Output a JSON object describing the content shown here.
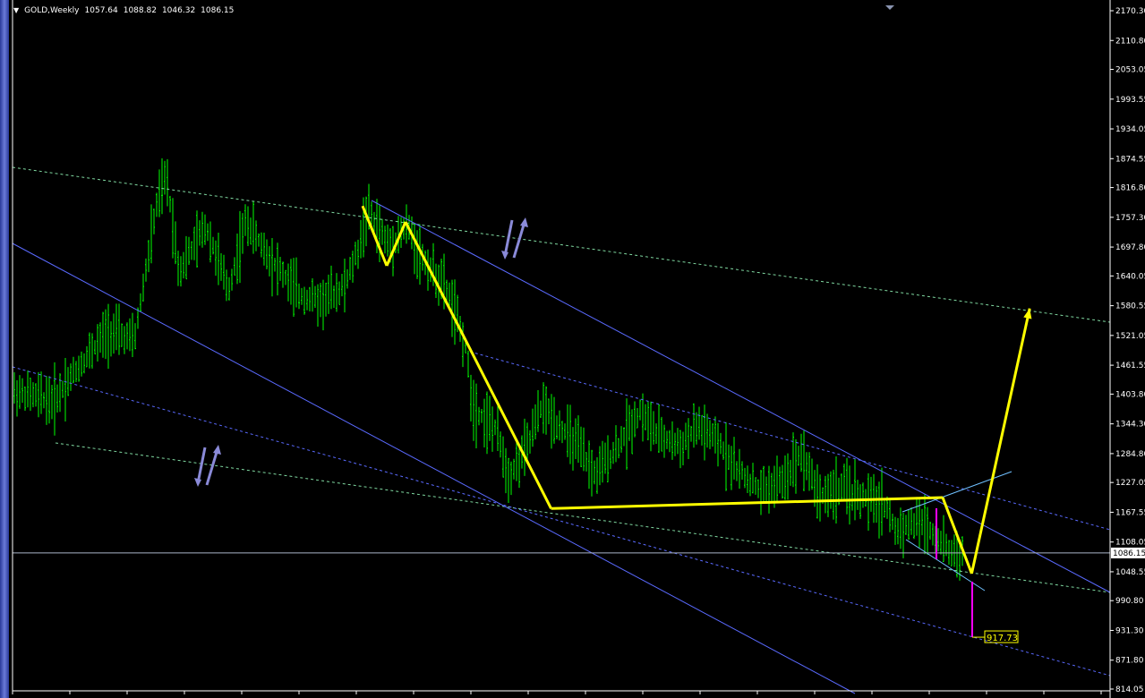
{
  "header": {
    "symbol": "GOLD,Weekly",
    "open": "1057.64",
    "high": "1088.82",
    "low": "1046.32",
    "close": "1086.15"
  },
  "chart_data": {
    "type": "line",
    "symbol": "GOLD",
    "timeframe": "Weekly",
    "y_ticks": [
      "2170.30",
      "2110.80",
      "2053.05",
      "1993.55",
      "1934.05",
      "1874.55",
      "1816.80",
      "1757.30",
      "1697.80",
      "1640.05",
      "1580.55",
      "1521.05",
      "1461.55",
      "1403.80",
      "1344.30",
      "1284.80",
      "1227.05",
      "1167.55",
      "1108.05",
      "1048.55",
      "990.80",
      "931.30",
      "871.80",
      "814.05"
    ],
    "ylim": [
      814.05,
      2170.3
    ],
    "current_price_label": "1086.15",
    "current_price": 1086.15,
    "target_label": "917.73",
    "target_value": 917.73,
    "zigzag_path": [
      {
        "x": 0.0,
        "y": 1780
      },
      {
        "x": 0.04,
        "y": 1710
      },
      {
        "x": 0.08,
        "y": 1760
      },
      {
        "x": 0.26,
        "y": 1175
      },
      {
        "x": 0.8,
        "y": 1197
      },
      {
        "x": 0.84,
        "y": 1045
      },
      {
        "x": 0.92,
        "y": 1575
      }
    ],
    "grid": false,
    "colors": {
      "bars": "#00ff00",
      "zigzag": "#ffff00",
      "channel": "#5a6aff",
      "trend": "#7fd8a0",
      "drop": "#ff00ff",
      "arrows": "#8a8ad8"
    }
  }
}
